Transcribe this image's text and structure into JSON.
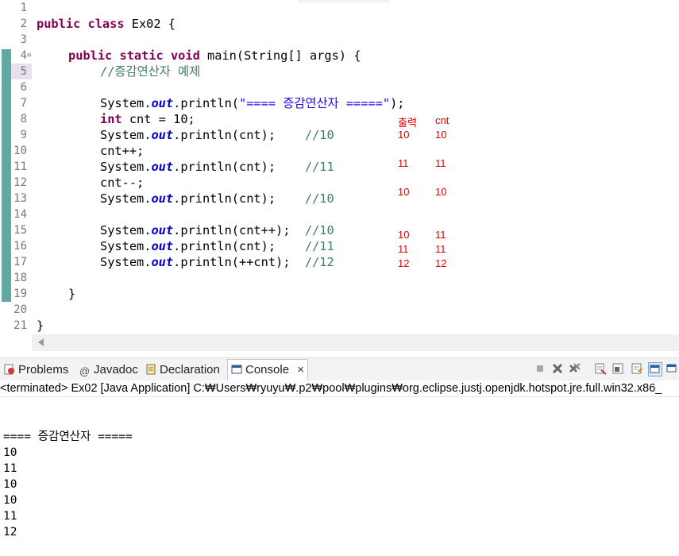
{
  "page_size": {
    "width": 855,
    "height": 647
  },
  "editor": {
    "line_numbers": [
      "1",
      "2",
      "3",
      "4",
      "5",
      "6",
      "7",
      "8",
      "9",
      "10",
      "11",
      "12",
      "13",
      "14",
      "15",
      "16",
      "17",
      "18",
      "19",
      "20",
      "21"
    ],
    "fold_marker": "⊖",
    "lines": {
      "l2": {
        "kw1": "public",
        "kw2": "class",
        "rest": " Ex02 {"
      },
      "l4": {
        "kw1": "public",
        "kw2": "static",
        "kw3": "void",
        "rest": " main(String[] args) {"
      },
      "l5": {
        "comment": "//증감연산자 예제"
      },
      "l7": {
        "pre": "System.",
        "field": "out",
        "mid": ".println(",
        "str": "\"==== 증감연산자 =====\"",
        "post": ");"
      },
      "l8": {
        "kw": "int",
        "rest": " cnt = 10;"
      },
      "l9": {
        "pre": "System.",
        "field": "out",
        "mid": ".println(cnt);    ",
        "comment": "//10"
      },
      "l10": {
        "text": "cnt++;"
      },
      "l11": {
        "pre": "System.",
        "field": "out",
        "mid": ".println(cnt);    ",
        "comment": "//11"
      },
      "l12": {
        "text": "cnt--;"
      },
      "l13": {
        "pre": "System.",
        "field": "out",
        "mid": ".println(cnt);    ",
        "comment": "//10"
      },
      "l15": {
        "pre": "System.",
        "field": "out",
        "mid": ".println(cnt++);  ",
        "comment": "//10"
      },
      "l16": {
        "pre": "System.",
        "field": "out",
        "mid": ".println(cnt);    ",
        "comment": "//11"
      },
      "l17": {
        "pre": "System.",
        "field": "out",
        "mid": ".println(++cnt);  ",
        "comment": "//12"
      },
      "l19": {
        "text": "}"
      },
      "l21": {
        "text": "}"
      }
    },
    "annotations": {
      "header_output": "출력",
      "header_cnt": "cnt",
      "rows": [
        {
          "out": "10",
          "cnt": "10"
        },
        {
          "out": "11",
          "cnt": "11"
        },
        {
          "out": "10",
          "cnt": "10"
        },
        {
          "out": "10",
          "cnt": "11"
        },
        {
          "out": "11",
          "cnt": "11"
        },
        {
          "out": "12",
          "cnt": "12"
        }
      ]
    }
  },
  "tabs": {
    "problems": "Problems",
    "javadoc": "Javadoc",
    "declaration": "Declaration",
    "console": "Console",
    "close_glyph": "×"
  },
  "console": {
    "status": "<terminated> Ex02 [Java Application] C:₩Users₩ryuyu₩.p2₩pool₩plugins₩org.eclipse.justj.openjdk.hotspot.jre.full.win32.x86_",
    "output": [
      "==== 증감연산자 =====",
      "10",
      "11",
      "10",
      "10",
      "11",
      "12"
    ]
  },
  "colors": {
    "keyword": "#7f0055",
    "string": "#2a00ff",
    "comment": "#3f7f5f",
    "annotation": "#e00000"
  }
}
